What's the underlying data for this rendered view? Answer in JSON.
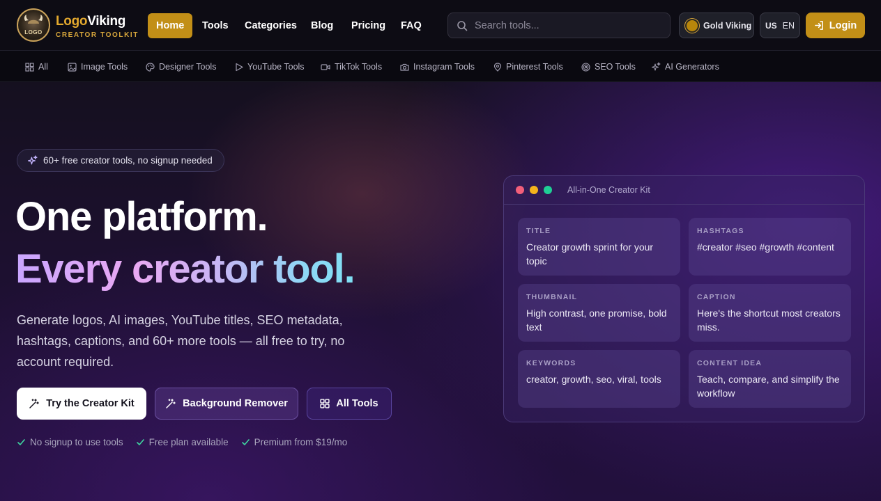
{
  "brand": {
    "logo_text": "LOGO",
    "name_part1": "Logo",
    "name_part2": "Viking",
    "tagline": "CREATOR TOOLKIT"
  },
  "nav": {
    "items": [
      {
        "label": "Home",
        "active": true
      },
      {
        "label": "Tools"
      },
      {
        "label": "Categories"
      },
      {
        "label": "Blog"
      },
      {
        "label": "Pricing"
      },
      {
        "label": "FAQ"
      }
    ]
  },
  "search": {
    "placeholder": "Search tools..."
  },
  "account": {
    "tier_label": "Gold Viking",
    "lang_flag": "US",
    "lang_code": "EN",
    "login_label": "Login"
  },
  "categories": [
    {
      "label": "All",
      "icon": "grid-icon"
    },
    {
      "label": "Image Tools",
      "icon": "image-icon"
    },
    {
      "label": "Designer Tools",
      "icon": "palette-icon"
    },
    {
      "label": "YouTube Tools",
      "icon": "play-icon"
    },
    {
      "label": "TikTok Tools",
      "icon": "video-icon"
    },
    {
      "label": "Instagram Tools",
      "icon": "camera-icon"
    },
    {
      "label": "Pinterest Tools",
      "icon": "pin-icon"
    },
    {
      "label": "SEO Tools",
      "icon": "target-icon"
    },
    {
      "label": "AI Generators",
      "icon": "sparkles-icon"
    }
  ],
  "hero": {
    "chip": "60+ free creator tools, no signup needed",
    "headline_line1": "One platform.",
    "headline_line2": "Every creator tool.",
    "lead": "Generate logos, AI images, YouTube titles, SEO metadata, hashtags, captions, and 60+ more tools — all free to try, no account required.",
    "buttons": {
      "primary": "Try the Creator Kit",
      "secondary": "Background Remover",
      "tertiary": "All Tools"
    },
    "checks": [
      "No signup to use tools",
      "Free plan available",
      "Premium from $19/mo"
    ]
  },
  "kit": {
    "title": "All-in-One Creator Kit",
    "tiles": [
      {
        "label": "TITLE",
        "text": "Creator growth sprint for your topic"
      },
      {
        "label": "HASHTAGS",
        "text": "#creator #seo #growth #content"
      },
      {
        "label": "THUMBNAIL",
        "text": "High contrast, one promise, bold text"
      },
      {
        "label": "CAPTION",
        "text": "Here's the shortcut most creators miss."
      },
      {
        "label": "KEYWORDS",
        "text": "creator, growth, seo, viral, tools"
      },
      {
        "label": "CONTENT IDEA",
        "text": "Teach, compare, and simplify the workflow"
      }
    ]
  },
  "colors": {
    "accent_gold": "#c28f17",
    "window_dot_red": "#f25f7a",
    "window_dot_yellow": "#f5b31c",
    "window_dot_green": "#1fcf95",
    "check_green": "#3fd5a0"
  }
}
